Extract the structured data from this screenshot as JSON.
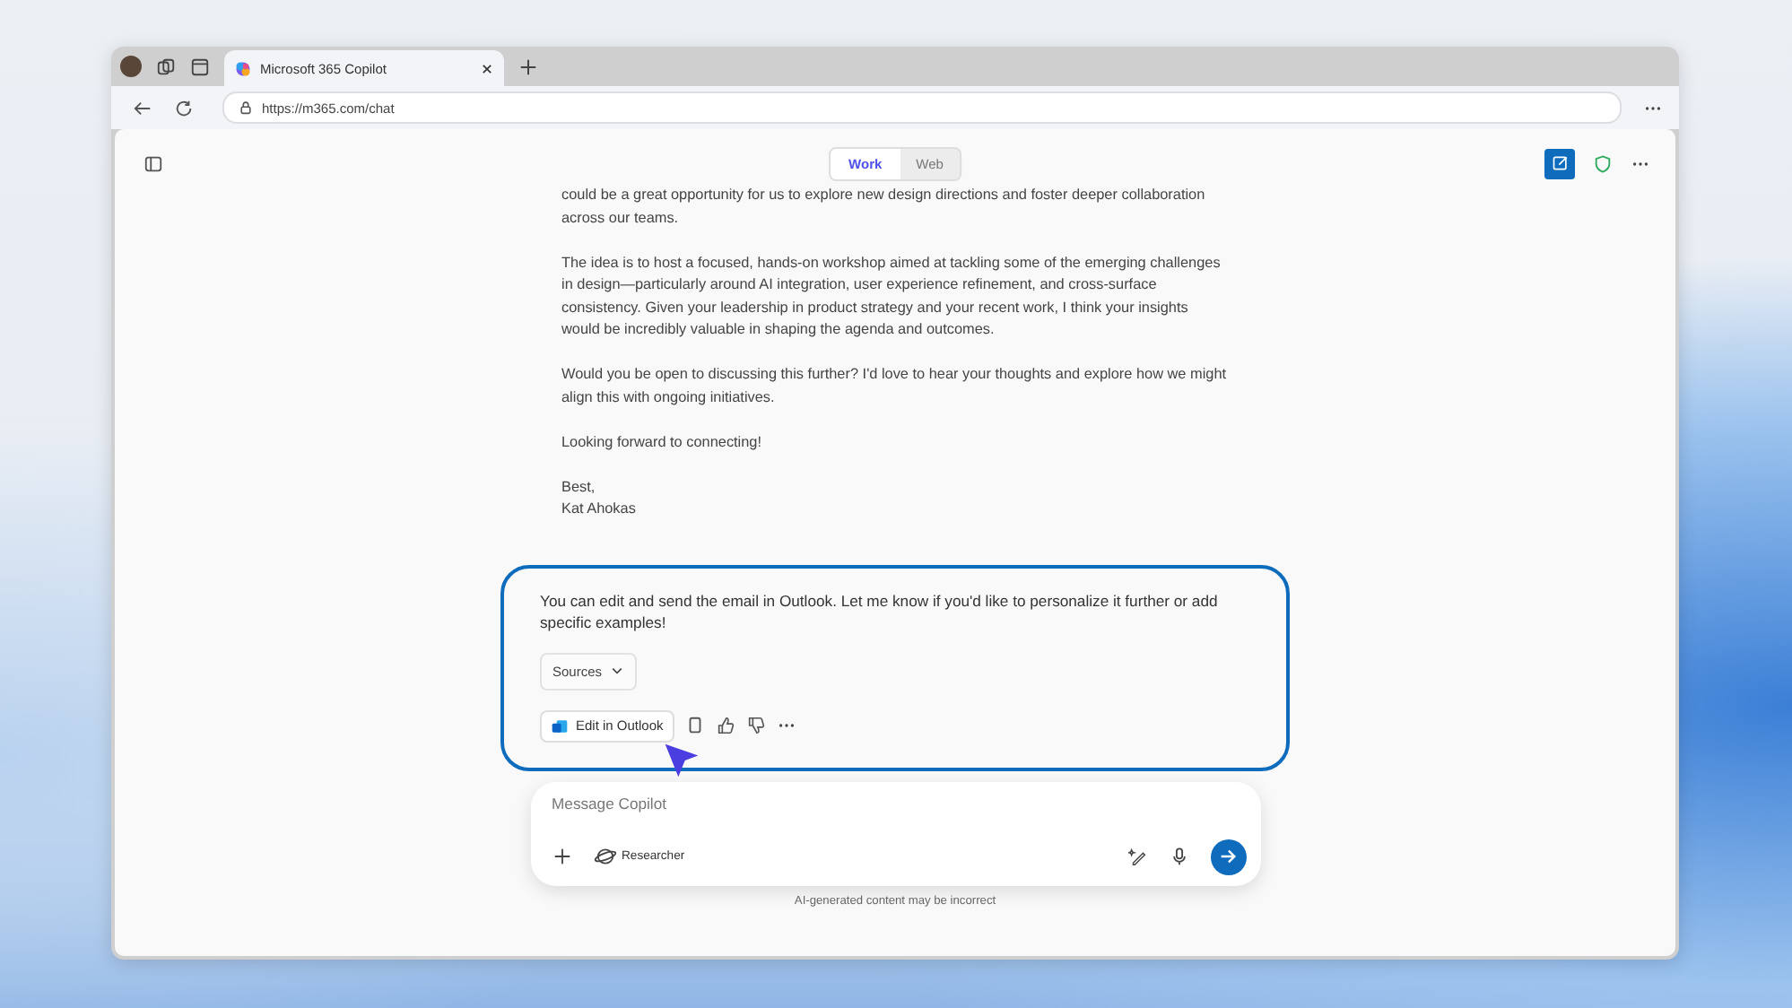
{
  "browser": {
    "tab_title": "Microsoft 365 Copilot",
    "url": "https://m365.com/chat"
  },
  "mode_tabs": [
    {
      "label": "Work",
      "selected": true
    },
    {
      "label": "Web",
      "selected": false
    }
  ],
  "email": {
    "paragraphs": [
      "could be a great opportunity for us to explore new design directions and foster deeper collaboration across our teams.",
      "The idea is to host a focused, hands-on workshop aimed at tackling some of the emerging challenges in design—particularly around AI integration, user experience refinement, and cross-surface consistency. Given your leadership in product strategy and your recent work, I think your insights would be incredibly valuable in shaping the agenda and outcomes.",
      "Would you be open to discussing this further? I'd love to hear your thoughts and explore how we might align this with ongoing initiatives.",
      "Looking forward to connecting!"
    ],
    "closing": "Best,",
    "signature": "Kat Ahokas"
  },
  "response": {
    "text": "You can edit and send the email in Outlook. Let me know if you'd like to personalize it further or add specific examples!",
    "sources_label": "Sources",
    "edit_button": "Edit in Outlook"
  },
  "composer": {
    "placeholder": "Message Copilot",
    "agent": "Researcher"
  },
  "disclaimer": "AI-generated content may be incorrect"
}
